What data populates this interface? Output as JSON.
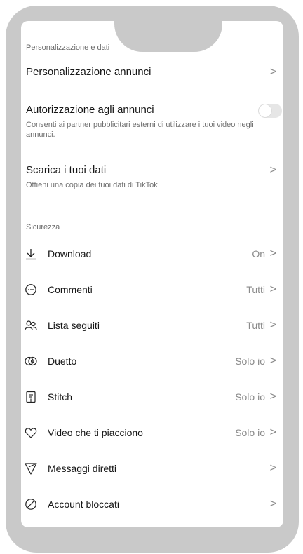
{
  "header": {
    "section_personalization": "Personalizzazione e dati",
    "section_security": "Sicurezza"
  },
  "personalization": {
    "ads_personalization": {
      "title": "Personalizzazione annunci"
    },
    "ads_authorization": {
      "title": "Autorizzazione agli annunci",
      "subtitle": "Consenti ai partner pubblicitari esterni di utilizzare i tuoi video negli annunci.",
      "toggle_on": false
    },
    "download_data": {
      "title": "Scarica i tuoi dati",
      "subtitle": "Ottieni una copia dei tuoi dati di TikTok"
    }
  },
  "security_items": [
    {
      "label": "Download",
      "value": "On",
      "icon": "download-icon"
    },
    {
      "label": "Commenti",
      "value": "Tutti",
      "icon": "comment-icon"
    },
    {
      "label": "Lista seguiti",
      "value": "Tutti",
      "icon": "users-icon"
    },
    {
      "label": "Duetto",
      "value": "Solo io",
      "icon": "duet-icon"
    },
    {
      "label": "Stitch",
      "value": "Solo io",
      "icon": "stitch-icon"
    },
    {
      "label": "Video che ti piacciono",
      "value": "Solo io",
      "icon": "heart-icon"
    },
    {
      "label": "Messaggi diretti",
      "value": "",
      "icon": "send-icon"
    },
    {
      "label": "Account bloccati",
      "value": "",
      "icon": "block-icon"
    }
  ],
  "chevron": ">",
  "colors": {
    "frame": "#c9c9c9",
    "text_primary": "#161616",
    "text_secondary": "#8a8a8a"
  }
}
